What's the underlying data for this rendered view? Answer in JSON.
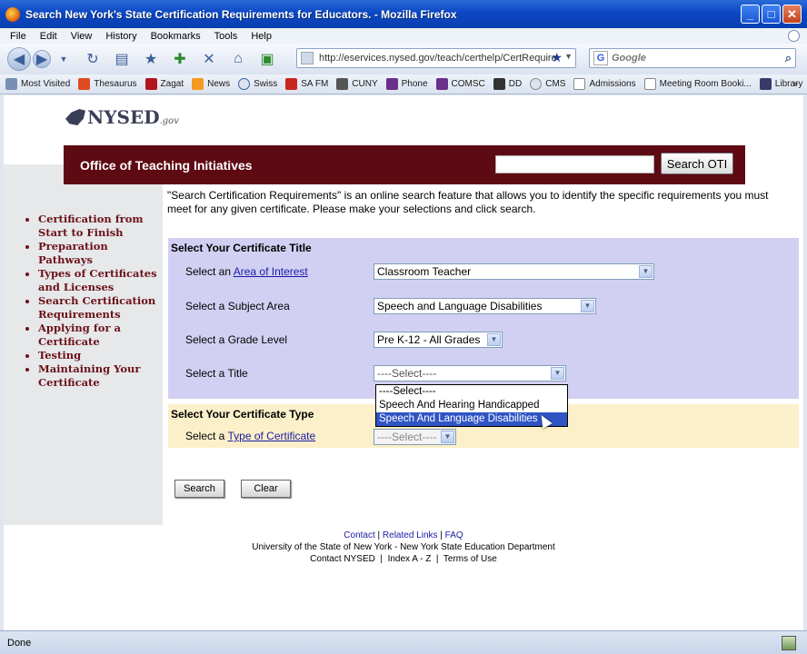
{
  "window": {
    "title": "Search New York's State Certification Requirements for Educators. - Mozilla Firefox"
  },
  "menu": [
    "File",
    "Edit",
    "View",
    "History",
    "Bookmarks",
    "Tools",
    "Help"
  ],
  "nav": {
    "url": "http://eservices.nysed.gov/teach/certhelp/CertRequire",
    "search_engine": "Google"
  },
  "bookmarks": [
    "Most Visited",
    "Thesaurus",
    "Zagat",
    "News",
    "Swiss",
    "SA FM",
    "CUNY",
    "Phone",
    "COMSC",
    "DD",
    "CMS",
    "Admissions",
    "Meeting Room Booki...",
    "Library"
  ],
  "header": {
    "logo_text": "NYSED",
    "logo_suffix": ".gov",
    "office_title": "Office of Teaching Initiatives",
    "search_button": "Search OTI"
  },
  "sidebar": {
    "items": [
      "Certification from Start to Finish",
      "Preparation Pathways",
      "Types of Certificates and Licenses",
      "Search Certification Requirements",
      "Applying for a Certificate",
      "Testing",
      "Maintaining Your Certificate"
    ]
  },
  "main": {
    "intro": "\"Search Certification Requirements\" is an online search feature that allows you to identify the specific requirements you must meet for any given certificate. Please make your selections and click search.",
    "section1_title": "Select Your Certificate Title",
    "area_prefix": "Select an ",
    "area_link": "Area of Interest",
    "area_value": "Classroom Teacher",
    "subject_label": "Select a Subject Area",
    "subject_value": "Speech and Language Disabilities",
    "grade_label": "Select a Grade Level",
    "grade_value": "Pre K-12 - All Grades",
    "title_label": "Select a Title",
    "title_value": "----Select----",
    "title_options": [
      "----Select----",
      "Speech And Hearing Handicapped",
      "Speech And Language Disabilities"
    ],
    "section2_title": "Select Your Certificate Type",
    "type_prefix": "Select a ",
    "type_link": "Type of Certificate",
    "type_value": "----Select----",
    "search_button": "Search",
    "clear_button": "Clear"
  },
  "footer": {
    "contact": "Contact",
    "related_links": "Related Links",
    "faq": "FAQ",
    "line2": "University of the State of New York - New York State Education Department",
    "line3": "Contact NYSED  |  Index A - Z  |  Terms of Use"
  },
  "status": {
    "text": "Done"
  }
}
